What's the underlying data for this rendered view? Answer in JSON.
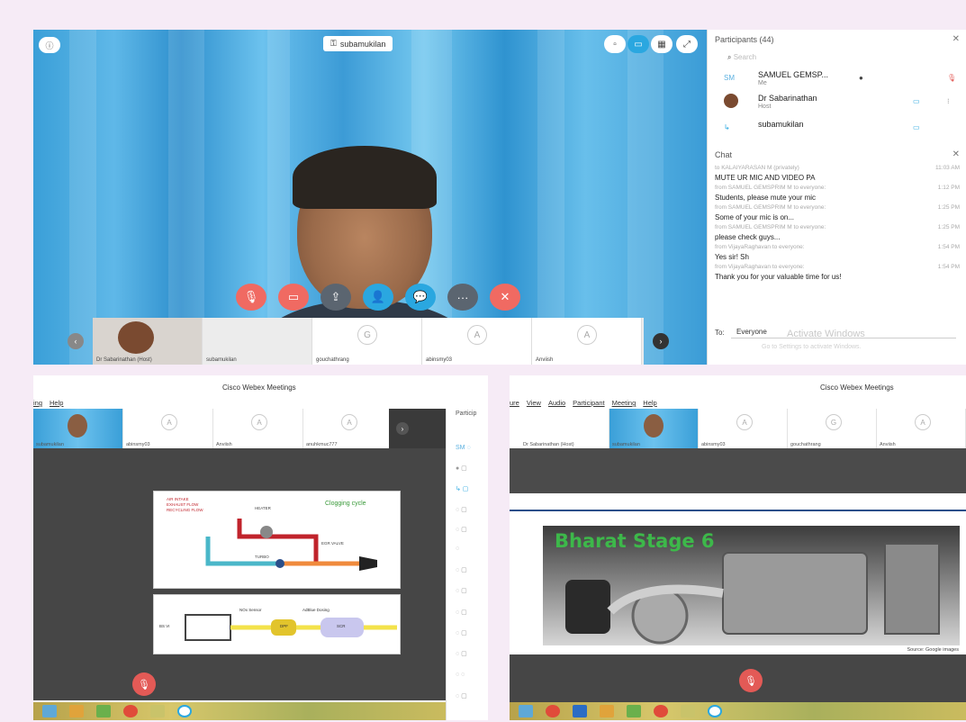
{
  "top": {
    "badge_text": "subamukilan",
    "controls": [
      {
        "name": "mute-button",
        "color": "#f06a62",
        "glyph": "🎙"
      },
      {
        "name": "video-button",
        "color": "#f06a62",
        "glyph": "▭"
      },
      {
        "name": "share-button",
        "color": "#5b6570",
        "glyph": "⇪"
      },
      {
        "name": "participants-button",
        "color": "#2aa7e0",
        "glyph": "👤"
      },
      {
        "name": "chat-button",
        "color": "#2aa7e0",
        "glyph": "💬"
      },
      {
        "name": "more-button",
        "color": "#5b6570",
        "glyph": "···"
      },
      {
        "name": "leave-button",
        "color": "#f06a62",
        "glyph": "✕"
      }
    ],
    "thumbs": [
      {
        "label": "Dr Sabarinathan (Host)",
        "initial": ""
      },
      {
        "label": "subamukilan",
        "initial": ""
      },
      {
        "label": "gouchathrang",
        "initial": "G"
      },
      {
        "label": "abinsmy03",
        "initial": "A"
      },
      {
        "label": "Anviish",
        "initial": "A"
      }
    ]
  },
  "participants": {
    "header": "Participants (44)",
    "search_placeholder": "Search",
    "rows": [
      {
        "initials": "SM",
        "name": "SAMUEL GEMSP...",
        "role": "Me"
      },
      {
        "initials": "",
        "name": "Dr Sabarinathan",
        "role": "Host"
      },
      {
        "initials": "",
        "name": "subamukilan",
        "role": ""
      }
    ]
  },
  "chat": {
    "header": "Chat",
    "lines": [
      {
        "type": "meta",
        "text": "to KALAIYARASAN M (privately)",
        "time": "11:03 AM"
      },
      {
        "type": "msg",
        "text": "MUTE UR MIC AND VIDEO PA",
        "time": ""
      },
      {
        "type": "meta",
        "text": "from SAMUEL GEMSPRIM M to everyone:",
        "time": "1:12 PM"
      },
      {
        "type": "msg",
        "text": "Students, please mute your mic",
        "time": ""
      },
      {
        "type": "meta",
        "text": "from SAMUEL GEMSPRIM M to everyone:",
        "time": "1:25 PM"
      },
      {
        "type": "msg",
        "text": "Some of your mic is on...",
        "time": ""
      },
      {
        "type": "meta",
        "text": "from SAMUEL GEMSPRIM M to everyone:",
        "time": "1:25 PM"
      },
      {
        "type": "msg",
        "text": "please check guys...",
        "time": ""
      },
      {
        "type": "meta",
        "text": "from VijayaRaghavan to everyone:",
        "time": "1:54 PM"
      },
      {
        "type": "msg",
        "text": "Yes sir! Sh",
        "time": ""
      },
      {
        "type": "meta",
        "text": "from VijayaRaghavan to everyone:",
        "time": "1:54 PM"
      },
      {
        "type": "msg",
        "text": "Thank you for your valuable time for us!",
        "time": ""
      }
    ],
    "to_label": "To:",
    "to_value": "Everyone",
    "watermark": "Activate Windows",
    "watermark_sub": "Go to Settings to activate Windows."
  },
  "bottom_left": {
    "title": "Cisco Webex Meetings",
    "menu": [
      "ing",
      "Help"
    ],
    "thumbs": [
      {
        "label": "subamukilan",
        "initial": "",
        "video": true
      },
      {
        "label": "abinsmy03",
        "initial": "A",
        "video": false
      },
      {
        "label": "Anviish",
        "initial": "A",
        "video": false
      },
      {
        "label": "anuhkmuc777",
        "initial": "A",
        "video": false
      }
    ],
    "panel_header": "Particip",
    "slide_labels": {
      "legend_1": "AIR INTAKE",
      "legend_2": "EXHAUST FLOW",
      "legend_3": "RECYCLING FLOW",
      "heater": "HEATER",
      "clogging": "Clogging cycle",
      "egr": "EGR VALVE",
      "turbo": "TURBO",
      "dpf": "DPF",
      "scr": "SCR",
      "bsvi": "BS VI",
      "nox_sensor": "NOx Sensor",
      "adblue": "AdBlue Dosing"
    }
  },
  "bottom_right": {
    "title": "Cisco Webex Meetings",
    "menu": [
      "ure",
      "View",
      "Audio",
      "Participant",
      "Meeting",
      "Help"
    ],
    "thumbs": [
      {
        "label": "Dr Sabarinathan (Host)",
        "initial": "",
        "video": false
      },
      {
        "label": "subamukilan",
        "initial": "",
        "video": true
      },
      {
        "label": "abinsmy03",
        "initial": "A",
        "video": false
      },
      {
        "label": "gouchathrang",
        "initial": "G",
        "video": false
      },
      {
        "label": "Anviish",
        "initial": "A",
        "video": false
      }
    ],
    "slide_title": "Bharat Stage 6",
    "source": "Source: Google images"
  }
}
